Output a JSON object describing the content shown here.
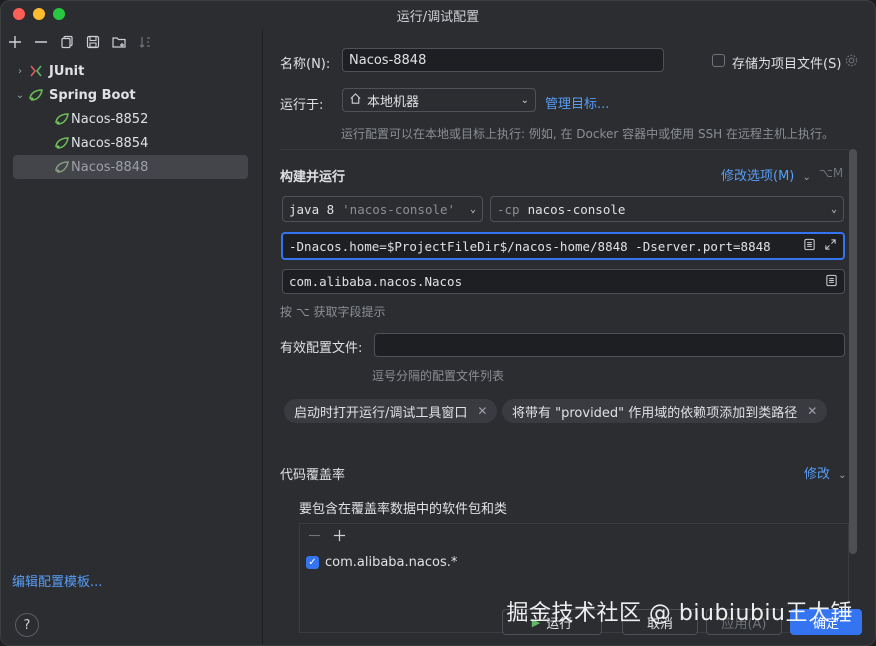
{
  "window": {
    "title": "运行/调试配置"
  },
  "toolbar": {
    "icons": [
      "add-icon",
      "remove-icon",
      "copy-icon",
      "save-icon",
      "folder-add-icon",
      "sort-icon"
    ]
  },
  "tree": {
    "junit": "JUnit",
    "spring_boot": "Spring Boot",
    "items": [
      "Nacos-8852",
      "Nacos-8854",
      "Nacos-8848"
    ]
  },
  "left_footer": {
    "edit_templates": "编辑配置模板...",
    "help": "?"
  },
  "form": {
    "name_label": "名称(N):",
    "name_value": "Nacos-8848",
    "store_as_file": "存储为项目文件(S)",
    "run_on_label": "运行于:",
    "run_on_value": "本地机器",
    "manage_targets": "管理目标...",
    "run_on_hint": "运行配置可以在本地或目标上执行: 例如, 在 Docker 容器中或使用 SSH 在远程主机上执行。",
    "build_run": "构建并运行",
    "modify_options": "修改选项(M)",
    "modify_shortcut": "⌥M",
    "jdk_prefix": "java 8",
    "jdk_module": "'nacos-console'",
    "cp_prefix": "-cp",
    "cp_value": "nacos-console",
    "vm_options": "-Dnacos.home=$ProjectFileDir$/nacos-home/8848 -Dserver.port=8848",
    "main_class": "com.alibaba.nacos.Nacos",
    "field_hint": "按 ⌥ 获取字段提示",
    "active_profiles_label": "有效配置文件:",
    "active_profiles_value": "",
    "profiles_hint": "逗号分隔的配置文件列表",
    "tag1": "启动时打开运行/调试工具窗口",
    "tag2": "将带有 \"provided\" 作用域的依赖项添加到类路径",
    "coverage": "代码覆盖率",
    "coverage_modify": "修改",
    "coverage_include": "要包含在覆盖率数据中的软件包和类",
    "package_entry": "com.alibaba.nacos.*"
  },
  "buttons": {
    "run": "运行",
    "cancel": "取消",
    "apply": "应用(A)",
    "ok": "确定"
  },
  "watermark": "掘金技术社区 @ biubiubiu王大锤",
  "colors": {
    "accent": "#3574f0",
    "link": "#589df6",
    "bg": "#2b2d30"
  }
}
